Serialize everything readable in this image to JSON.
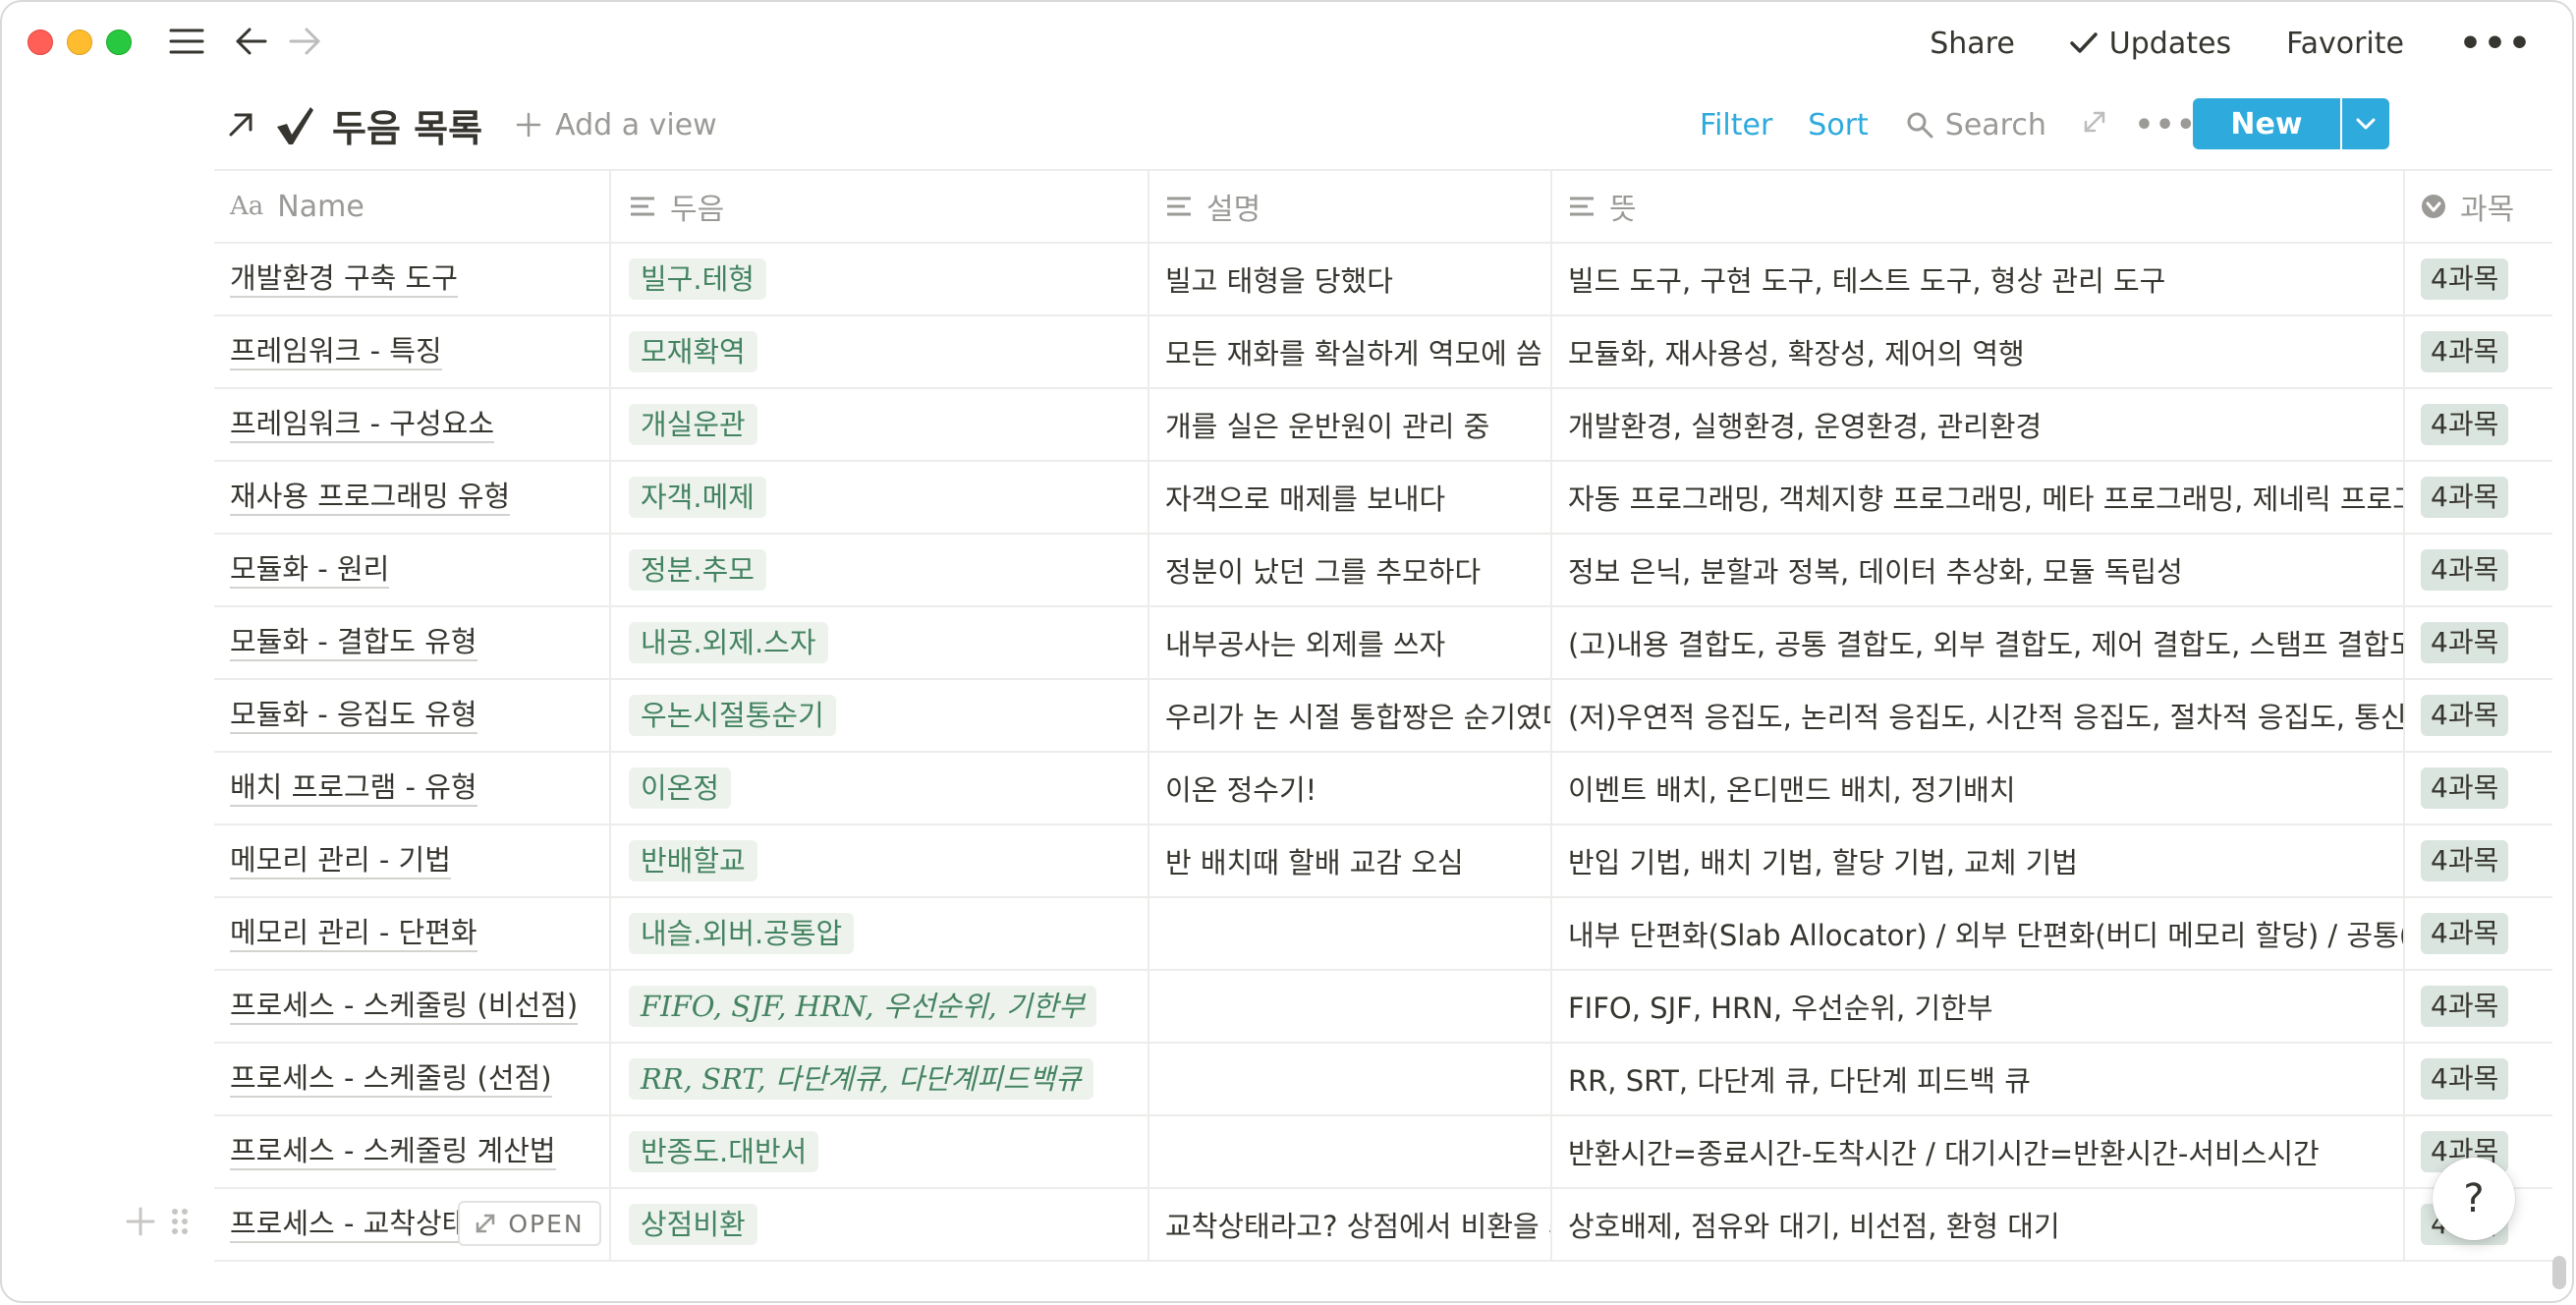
{
  "topbar": {
    "share": "Share",
    "updates": "Updates",
    "favorite": "Favorite",
    "more": "•••"
  },
  "db": {
    "title": "두음 목록",
    "add_view": "Add a view",
    "filter": "Filter",
    "sort": "Sort",
    "search": "Search",
    "more": "•••",
    "new": "New"
  },
  "columns": [
    "Name",
    "두음",
    "설명",
    "뜻",
    "과목"
  ],
  "rows": [
    {
      "name": "개발환경 구축 도구",
      "dueum": "빌구.테형",
      "desc": "빌고 태형을 당했다",
      "meaning": "빌드 도구, 구현 도구, 테스트 도구, 형상 관리 도구",
      "subject": "4과목"
    },
    {
      "name": "프레임워크 - 특징",
      "dueum": "모재확역",
      "desc": "모든 재화를 확실하게 역모에 씀",
      "meaning": "모듈화, 재사용성, 확장성, 제어의 역행",
      "subject": "4과목"
    },
    {
      "name": "프레임워크 - 구성요소",
      "dueum": "개실운관",
      "desc": "개를 실은 운반원이 관리 중",
      "meaning": "개발환경, 실행환경, 운영환경, 관리환경",
      "subject": "4과목"
    },
    {
      "name": "재사용 프로그래밍 유형",
      "dueum": "자객.메제",
      "desc": "자객으로 매제를 보내다",
      "meaning": "자동 프로그래밍, 객체지향 프로그래밍, 메타 프로그래밍, 제네릭 프로그래밍",
      "subject": "4과목"
    },
    {
      "name": "모듈화 - 원리",
      "dueum": "정분.추모",
      "desc": "정분이 났던 그를 추모하다",
      "meaning": "정보 은닉, 분할과 정복, 데이터 추상화, 모듈 독립성",
      "subject": "4과목"
    },
    {
      "name": "모듈화 - 결합도 유형",
      "dueum": "내공.외제.스자",
      "desc": "내부공사는 외제를 쓰자",
      "meaning": "(고)내용 결합도, 공통 결합도, 외부 결합도, 제어 결합도, 스탬프 결합도, 자료 결합도",
      "subject": "4과목"
    },
    {
      "name": "모듈화 - 응집도 유형",
      "dueum": "우논시절통순기",
      "desc": "우리가 논 시절 통합짱은 순기였다",
      "meaning": "(저)우연적 응집도, 논리적 응집도, 시간적 응집도, 절차적 응집도, 통신적 응집도",
      "subject": "4과목"
    },
    {
      "name": "배치 프로그램 - 유형",
      "dueum": "이온정",
      "desc": "이온 정수기!",
      "meaning": "이벤트 배치, 온디맨드 배치, 정기배치",
      "subject": "4과목"
    },
    {
      "name": "메모리 관리 - 기법",
      "dueum": "반배할교",
      "desc": "반 배치때 할배 교감 오심",
      "meaning": "반입 기법, 배치 기법, 할당 기법, 교체 기법",
      "subject": "4과목"
    },
    {
      "name": "메모리 관리 - 단편화",
      "dueum": "내슬.외버.공통압",
      "desc": "",
      "meaning": "내부 단편화(Slab Allocator) / 외부 단편화(버디 메모리 할당) / 공통(압축)",
      "subject": "4과목"
    },
    {
      "name": "프로세스 - 스케줄링 (비선점)",
      "dueum": "FIFO, SJF, HRN, 우선순위, 기한부",
      "dueum_math": true,
      "desc": "",
      "meaning": "FIFO, SJF, HRN, 우선순위, 기한부",
      "subject": "4과목"
    },
    {
      "name": "프로세스 - 스케줄링 (선점)",
      "dueum": "RR, SRT, 다단계큐, 다단계피드백큐",
      "dueum_math": true,
      "desc": "",
      "meaning": "RR, SRT, 다단계 큐, 다단계 피드백 큐",
      "subject": "4과목"
    },
    {
      "name": "프로세스 - 스케줄링 계산법",
      "dueum": "반종도.대반서",
      "desc": "",
      "meaning": "반환시간=종료시간-도착시간 / 대기시간=반환시간-서비스시간",
      "subject": "4과목"
    },
    {
      "name": "프로세스 - 교착상태",
      "dueum": "상점비환",
      "desc": "교착상태라고? 상점에서 비환을 사",
      "meaning": "상호배제, 점유와 대기, 비선점, 환형 대기",
      "subject": "4과목",
      "hover": true
    }
  ],
  "hover_row": {
    "open_label": "OPEN"
  },
  "help": "?"
}
